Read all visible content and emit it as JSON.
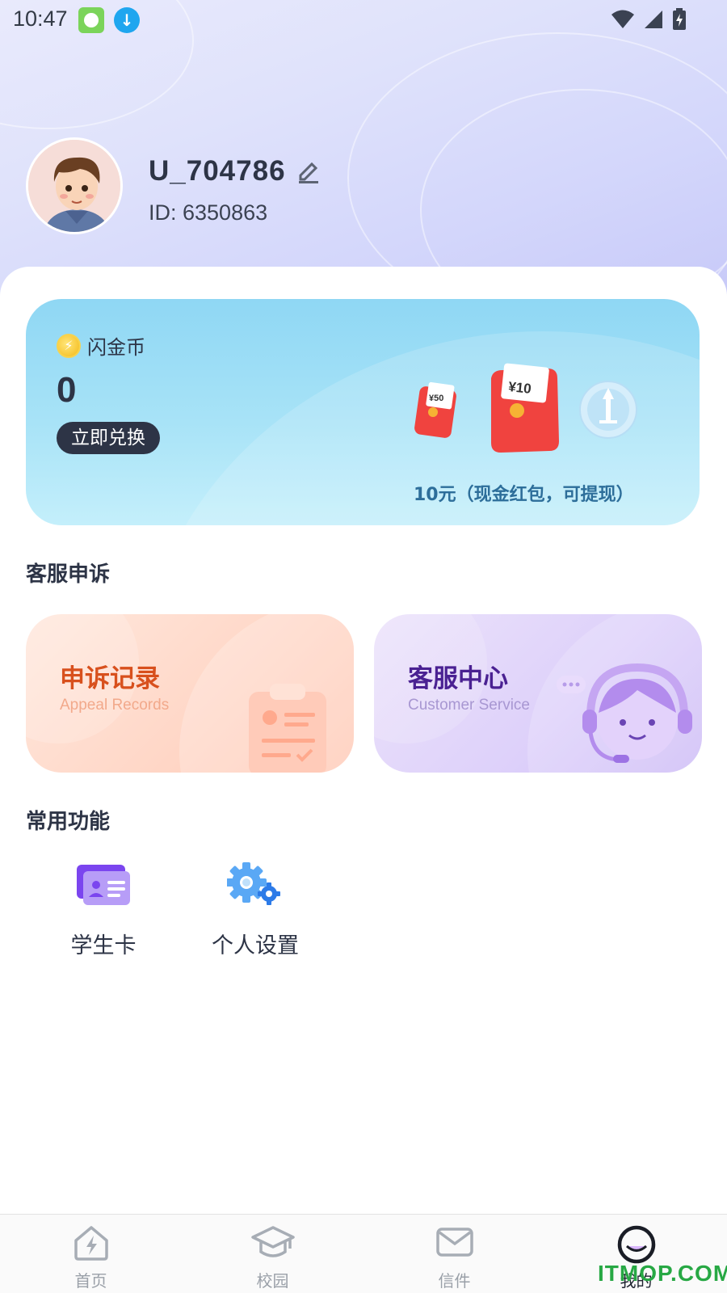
{
  "status_bar": {
    "time": "10:47"
  },
  "profile": {
    "username": "U_704786",
    "user_id": "ID: 6350863"
  },
  "coin_card": {
    "label": "闪金币",
    "value": "0",
    "redeem_label": "立即兑换",
    "reward_small": "¥50",
    "reward_large": "¥10",
    "reward_caption": "10元（现金红包，可提现）"
  },
  "service_section": {
    "title": "客服申诉",
    "appeal": {
      "title": "申诉记录",
      "subtitle": "Appeal Records"
    },
    "customer_service": {
      "title": "客服中心",
      "subtitle": "Customer Service"
    }
  },
  "features_section": {
    "title": "常用功能",
    "items": [
      {
        "label": "学生卡",
        "icon": "student-card-icon"
      },
      {
        "label": "个人设置",
        "icon": "settings-gear-icon"
      }
    ]
  },
  "bottom_nav": {
    "items": [
      {
        "label": "首页",
        "icon": "home-icon"
      },
      {
        "label": "校园",
        "icon": "graduation-cap-icon"
      },
      {
        "label": "信件",
        "icon": "mail-icon"
      },
      {
        "label": "我的",
        "icon": "profile-icon"
      }
    ]
  },
  "watermark": "ITMOP.COM",
  "colors": {
    "accent_dark": "#2d3446",
    "appeal_title": "#d8501d",
    "service_title": "#4a2192",
    "reward_caption": "#2d6e9a",
    "watermark": "#27a844"
  }
}
